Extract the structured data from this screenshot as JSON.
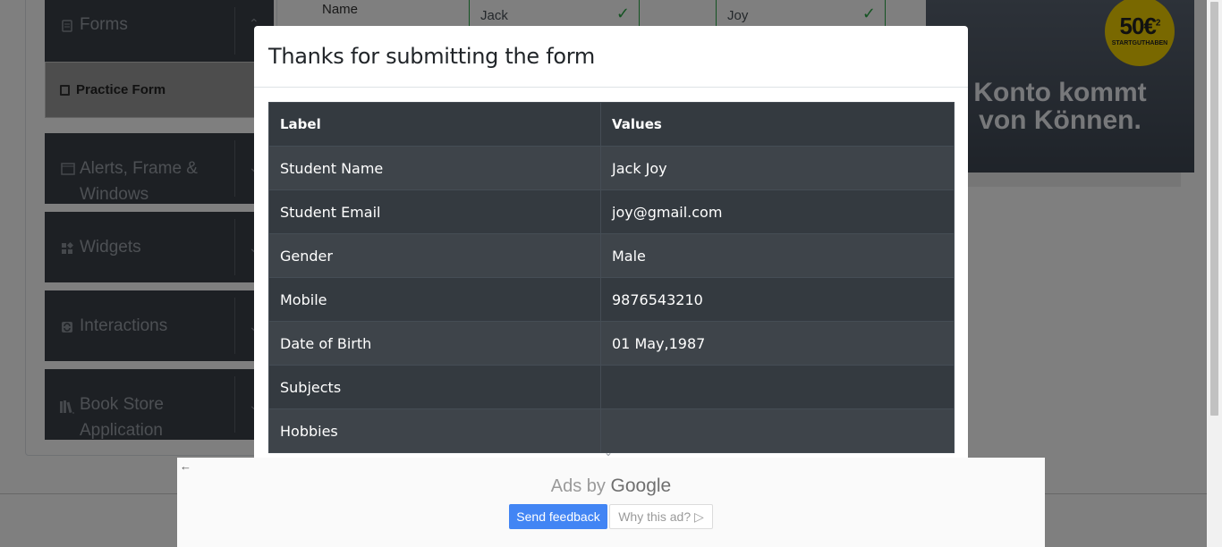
{
  "sidebar": {
    "groups": [
      {
        "label": "Forms",
        "icon": "file-icon"
      },
      {
        "label": "Alerts, Frame & Windows",
        "icon": "browser-window-icon"
      },
      {
        "label": "Widgets",
        "icon": "widgets-icon"
      },
      {
        "label": "Interactions",
        "icon": "interactions-icon"
      },
      {
        "label": "Book Store Application",
        "icon": "books-icon"
      }
    ],
    "active_item": "Practice Form"
  },
  "background_form": {
    "name_label": "Name",
    "first_name_value": "Jack",
    "last_name_value": "Joy"
  },
  "right_ad": {
    "badge_amount": "50€",
    "badge_sup": "2",
    "badge_caption": "STARTGUTHABEN",
    "slogan_line1": "Konto kommt",
    "slogan_line2": "von Können."
  },
  "modal": {
    "title": "Thanks for submitting the form",
    "headers": {
      "label": "Label",
      "values": "Values"
    },
    "rows": [
      {
        "label": "Student Name",
        "value": "Jack Joy"
      },
      {
        "label": "Student Email",
        "value": "joy@gmail.com"
      },
      {
        "label": "Gender",
        "value": "Male"
      },
      {
        "label": "Mobile",
        "value": "9876543210"
      },
      {
        "label": "Date of Birth",
        "value": "01 May,1987"
      },
      {
        "label": "Subjects",
        "value": ""
      },
      {
        "label": "Hobbies",
        "value": ""
      }
    ]
  },
  "ad_bar": {
    "ads_by": "Ads by",
    "google": "Google",
    "send_feedback": "Send feedback",
    "why_this_ad": "Why this ad? ▷"
  },
  "colors": {
    "table_dark": "#343a40",
    "table_stripe": "#3e444a",
    "feedback_blue": "#4285f4",
    "success_green": "#28a745",
    "badge_yellow": "#f2d100"
  }
}
